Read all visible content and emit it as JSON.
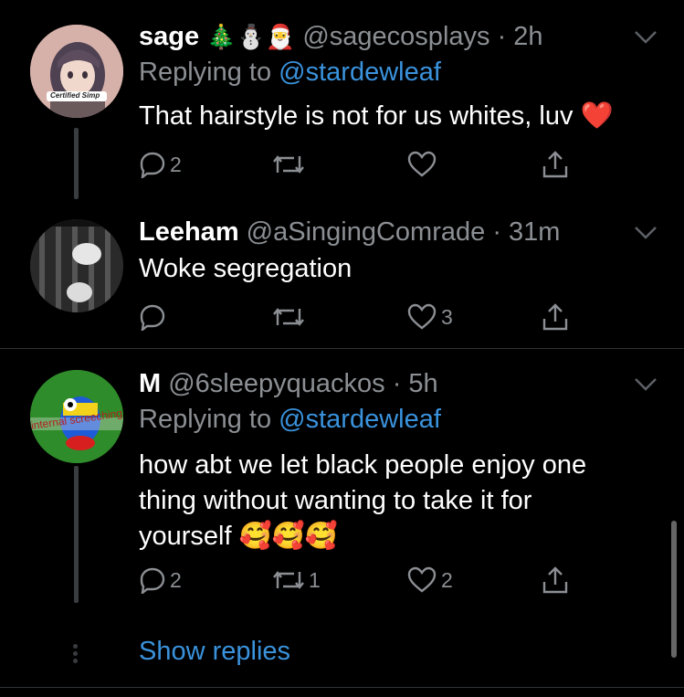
{
  "tweets": [
    {
      "name": "sage",
      "name_emoji": "🎄⛄🎅",
      "handle": "@sagecosplays",
      "time": "· 2h",
      "replying_prefix": "Replying to",
      "replying_handle": "@stardewleaf",
      "text": "That hairstyle is not for us whites, luv",
      "text_emoji": "❤️",
      "avatar_badge": "Certified Simp",
      "replies": "2",
      "retweets": "",
      "likes": ""
    },
    {
      "name": "Leeham",
      "handle": "@aSingingComrade",
      "time": "· 31m",
      "text": "Woke segregation",
      "replies": "",
      "retweets": "",
      "likes": "3"
    },
    {
      "name": "M",
      "handle": "@6sleepyquackos",
      "time": "· 5h",
      "replying_prefix": "Replying to",
      "replying_handle": "@stardewleaf",
      "text_line1": "how abt we let black people enjoy one",
      "text_line2": "thing without wanting to take it for",
      "text_line3": "yourself",
      "text_emoji": "🥰🥰🥰",
      "avatar_text": "internal screeching",
      "replies": "2",
      "retweets": "1",
      "likes": "2"
    }
  ],
  "show_replies": "Show replies",
  "colors": {
    "link": "#3a92dc",
    "muted": "#8b8f93",
    "like_heart": "#e0245e"
  }
}
